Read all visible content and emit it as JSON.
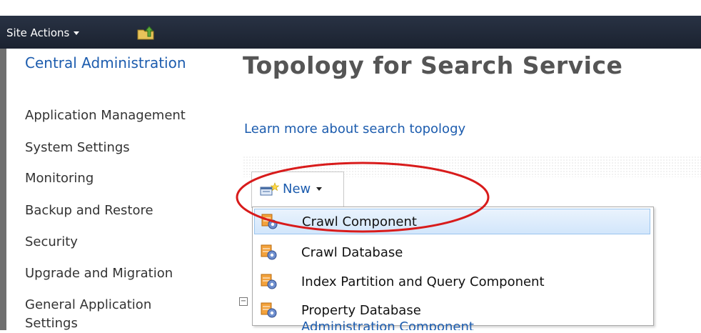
{
  "topbar": {
    "site_actions_label": "Site Actions"
  },
  "leftnav": {
    "heading": "Central Administration",
    "items": [
      {
        "label": "Application Management"
      },
      {
        "label": "System Settings"
      },
      {
        "label": "Monitoring"
      },
      {
        "label": "Backup and Restore"
      },
      {
        "label": "Security"
      },
      {
        "label": "Upgrade and Migration"
      },
      {
        "label": "General Application Settings"
      }
    ]
  },
  "main": {
    "title": "Topology for Search Service",
    "learn_more": "Learn more about search topology",
    "new_button_label": "New",
    "menu_items": [
      {
        "label": "Crawl Component",
        "highlighted": true
      },
      {
        "label": "Crawl Database"
      },
      {
        "label": "Index Partition and Query Component"
      },
      {
        "label": "Property Database"
      }
    ],
    "partial_text": "Administration Component"
  },
  "colors": {
    "topbar": "#1b2230",
    "link": "#1c5cae",
    "title": "#555555",
    "annotation": "#d81b1b"
  }
}
